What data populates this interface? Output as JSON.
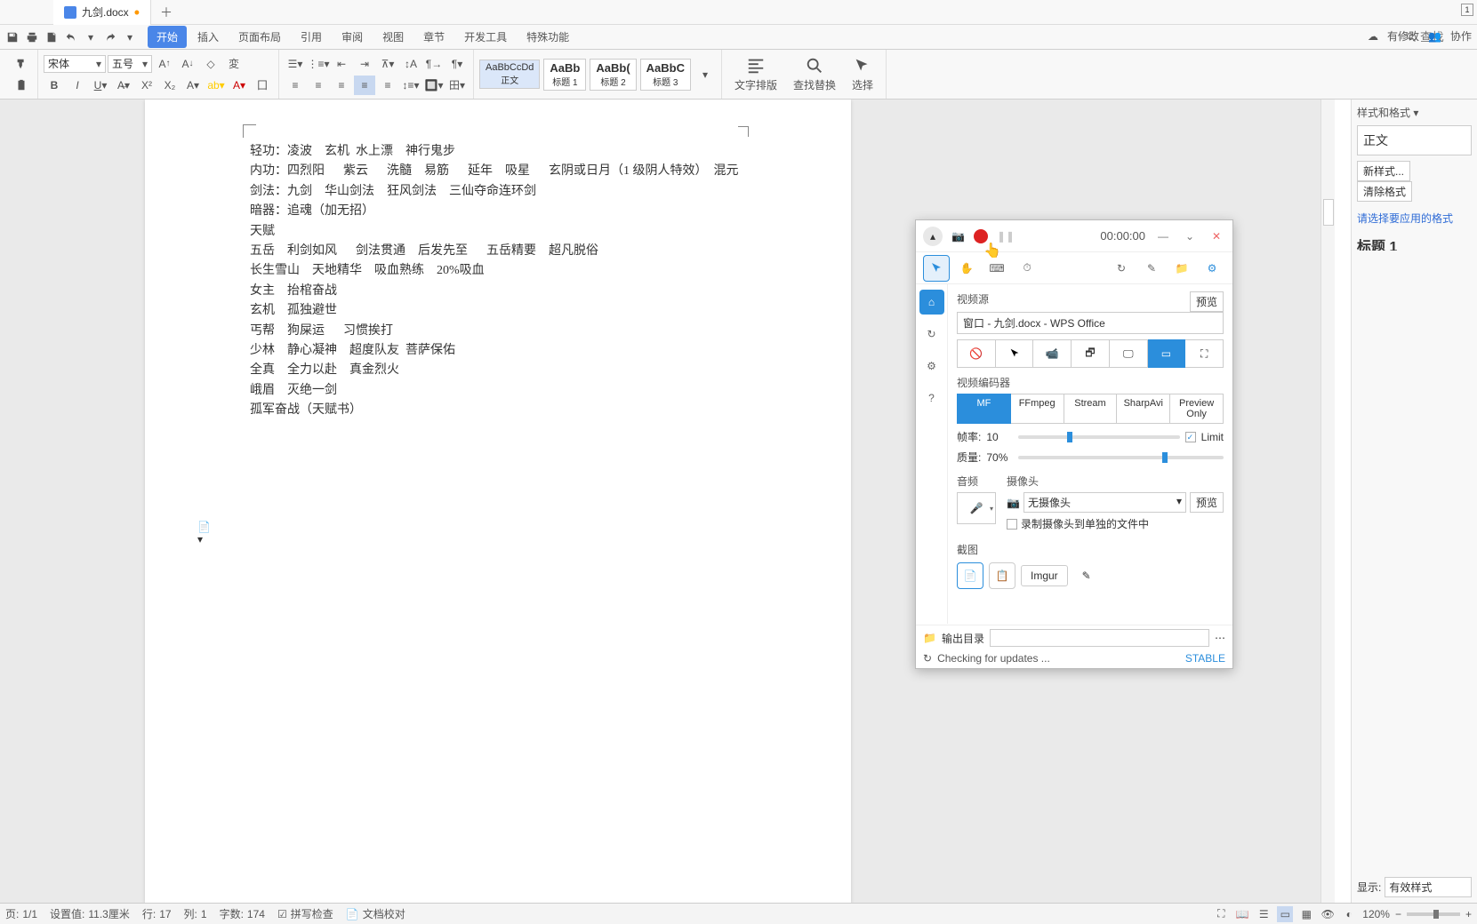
{
  "tab": {
    "filename": "九剑.docx",
    "modified": "•"
  },
  "top_badge": "1",
  "ribbon_tabs": [
    "开始",
    "插入",
    "页面布局",
    "引用",
    "审阅",
    "视图",
    "章节",
    "开发工具",
    "特殊功能"
  ],
  "search_placeholder": "查找",
  "right_actions": {
    "modify": "有修改",
    "collab": "协作"
  },
  "font": {
    "family": "宋体",
    "size": "五号"
  },
  "styles": [
    {
      "sample": "AaBbCcDd",
      "name": "正文"
    },
    {
      "sample": "AaBb",
      "name": "标题 1"
    },
    {
      "sample": "AaBb(",
      "name": "标题 2"
    },
    {
      "sample": "AaBbC",
      "name": "标题 3"
    }
  ],
  "big_buttons": {
    "text_layout": "文字排版",
    "find_replace": "查找替换",
    "select": "选择"
  },
  "document_lines": [
    "轻功：凌波    玄机  水上漂    神行鬼步",
    "内功：四烈阳      紫云      洗髓    易筋      延年    吸星      玄阴或日月（1 级阴人特效）  混元",
    "剑法：九剑    华山剑法    狂风剑法    三仙夺命连环剑",
    "暗器：追魂（加无招）",
    "",
    "天赋",
    "五岳    利剑如风      剑法贯通    后发先至      五岳精要    超凡脱俗",
    "长生雪山    天地精华    吸血熟练    20%吸血",
    "女主    抬棺奋战",
    "玄机    孤独避世",
    "丐帮    狗屎运      习惯挨打",
    "少林    静心凝神    超度队友  菩萨保佑",
    "全真    全力以赴    真金烈火",
    "峨眉    灭绝一剑",
    "孤军奋战（天赋书）"
  ],
  "styles_panel": {
    "title": "样式和格式",
    "current": "正文",
    "new_style": "新样式...",
    "clear": "清除格式",
    "hint": "请选择要应用的格式",
    "cutoff": "标题 1",
    "show_label": "显示:",
    "show_value": "有效样式"
  },
  "status": {
    "page": "1/1",
    "pos_label": "设置值:",
    "pos": "11.3厘米",
    "line_label": "行:",
    "line": "17",
    "col_label": "列:",
    "col": "1",
    "words_label": "字数:",
    "words": "174",
    "spell": "拼写检查",
    "proof": "文档校对",
    "zoom": "120%"
  },
  "recorder": {
    "timer": "00:00:00",
    "source_title": "视频源",
    "preview_btn": "预览",
    "source_value": "窗口 - 九剑.docx - WPS Office",
    "encoder_title": "视频编码器",
    "encoders": [
      "MF",
      "FFmpeg",
      "Stream",
      "SharpAvi",
      "Preview Only"
    ],
    "fps_label": "帧率:",
    "fps": "10",
    "limit": "Limit",
    "quality_label": "质量:",
    "quality": "70%",
    "audio_title": "音频",
    "camera_title": "摄像头",
    "camera_value": "无摄像头",
    "camera_preview": "预览",
    "camera_record_separate": "录制摄像头到单独的文件中",
    "screenshot_title": "截图",
    "imgur": "Imgur",
    "output_label": "输出目录",
    "update": "Checking for updates ...",
    "stable": "STABLE"
  }
}
